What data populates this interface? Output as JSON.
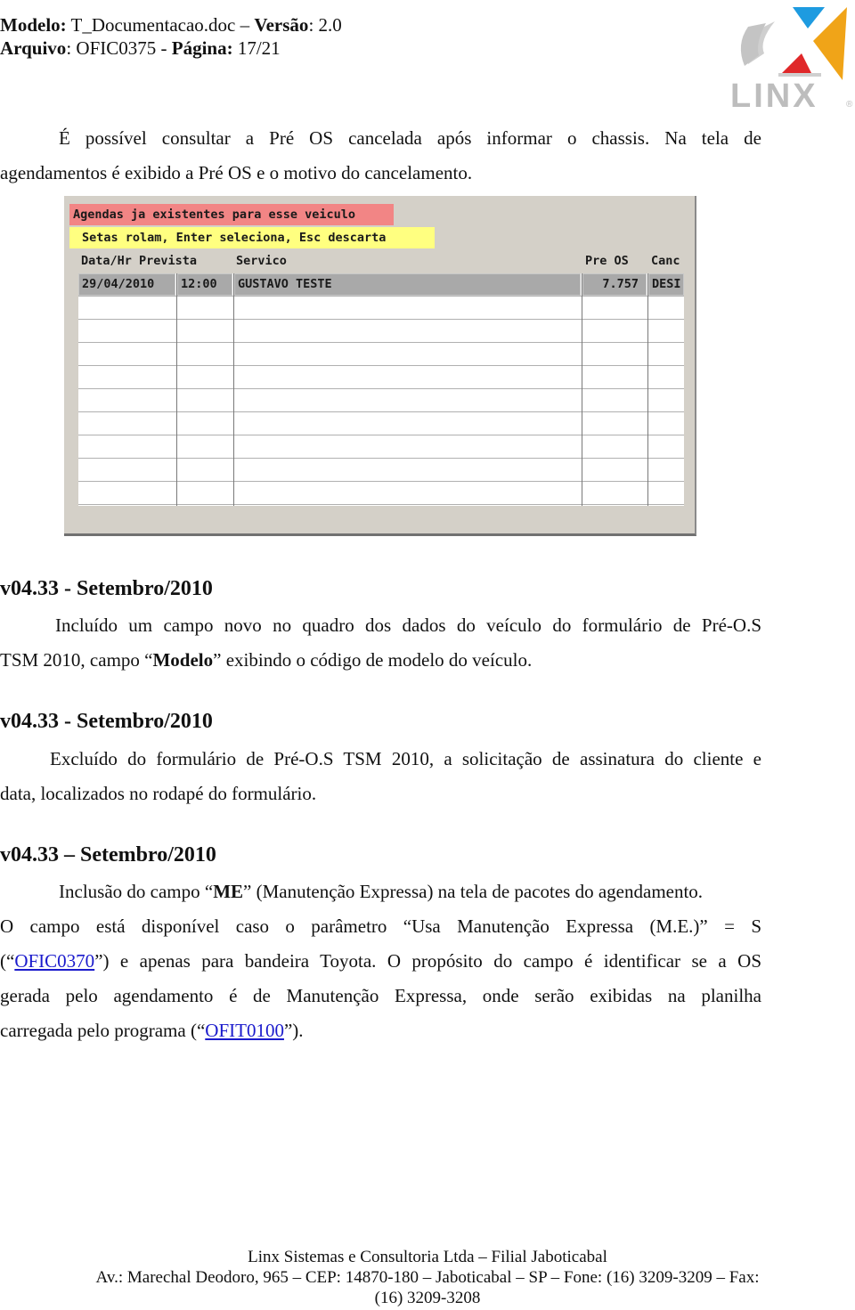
{
  "header": {
    "line1": {
      "modelo_label": "Modelo:",
      "modelo_value": " T_Documentacao.doc – ",
      "versao_label": "Versão",
      "versao_value": ": 2.0"
    },
    "line2": {
      "arquivo_label": "Arquivo",
      "arquivo_value": ": OFIC0375 - ",
      "pagina_label": "Página:",
      "pagina_value": " 17/21"
    },
    "logo": {
      "icon": "linx-logo-icon",
      "text": "LINX",
      "registered": "®",
      "colors": {
        "blue": "#1e9be0",
        "orange": "#f0a418",
        "red": "#e0282a",
        "gray": "#c8c8c8"
      }
    }
  },
  "intro": {
    "line1": "É possível consultar a Pré OS cancelada após informar o chassis. Na tela de",
    "line2": "agendamentos é exibido a Pré OS e o motivo do cancelamento."
  },
  "screenshot": {
    "banner_title": "Agendas ja existentes para esse veiculo",
    "banner_hint": "Setas rolam, Enter seleciona, Esc descarta",
    "colors": {
      "panel": "#d4d0c8",
      "banner_red": "#f28585",
      "banner_yellow": "#ffff80",
      "selected_row": "#a9a9a9"
    },
    "columns": {
      "data_hr": "Data/Hr Prevista",
      "servico": "Servico",
      "pre_os": "Pre OS",
      "canc": "Canc"
    },
    "rows": [
      {
        "data": "29/04/2010",
        "hora": "12:00",
        "servico": "GUSTAVO TESTE",
        "pre_os": "7.757",
        "canc": "DESI"
      },
      {
        "data": "",
        "hora": "",
        "servico": "",
        "pre_os": "",
        "canc": ""
      },
      {
        "data": "",
        "hora": "",
        "servico": "",
        "pre_os": "",
        "canc": ""
      },
      {
        "data": "",
        "hora": "",
        "servico": "",
        "pre_os": "",
        "canc": ""
      },
      {
        "data": "",
        "hora": "",
        "servico": "",
        "pre_os": "",
        "canc": ""
      },
      {
        "data": "",
        "hora": "",
        "servico": "",
        "pre_os": "",
        "canc": ""
      },
      {
        "data": "",
        "hora": "",
        "servico": "",
        "pre_os": "",
        "canc": ""
      },
      {
        "data": "",
        "hora": "",
        "servico": "",
        "pre_os": "",
        "canc": ""
      },
      {
        "data": "",
        "hora": "",
        "servico": "",
        "pre_os": "",
        "canc": ""
      },
      {
        "data": "",
        "hora": "",
        "servico": "",
        "pre_os": "",
        "canc": ""
      }
    ]
  },
  "sections": [
    {
      "heading": "v04.33 - Setembro/2010",
      "line1": "Incluído um campo novo no quadro dos dados do veículo do formulário de Pré-O.S",
      "line2_pre": "TSM 2010, campo “",
      "line2_bold": "Modelo",
      "line2_post": "” exibindo o código de modelo do veículo."
    },
    {
      "heading": "v04.33 - Setembro/2010",
      "line1": "Excluído do formulário de Pré-O.S TSM 2010, a solicitação de assinatura do cliente e",
      "line2": "data, localizados no rodapé do formulário."
    },
    {
      "heading": "v04.33 – Setembro/2010",
      "line1_pre": "Inclusão do campo “",
      "line1_bold": "ME",
      "line1_post": "” (Manutenção Expressa) na tela de pacotes do agendamento.",
      "line2": "O campo está disponível caso o parâmetro “Usa Manutenção Expressa (M.E.)” = S",
      "line3_pre": "(“",
      "line3_link": "OFIC0370",
      "line3_post": "”) e apenas para bandeira Toyota. O propósito do campo é identificar se a OS",
      "line4": "gerada pelo agendamento é de Manutenção Expressa, onde serão exibidas na planilha",
      "line5_pre": "carregada pelo programa (“",
      "line5_link": "OFIT0100",
      "line5_post": "”).",
      "link_color": "#1a1acc"
    }
  ],
  "footer": {
    "line1": "Linx Sistemas e Consultoria Ltda – Filial Jaboticabal",
    "line2": "Av.: Marechal Deodoro, 965 – CEP: 14870-180 – Jaboticabal – SP – Fone: (16) 3209-3209 – Fax:",
    "line3": "(16) 3209-3208"
  }
}
